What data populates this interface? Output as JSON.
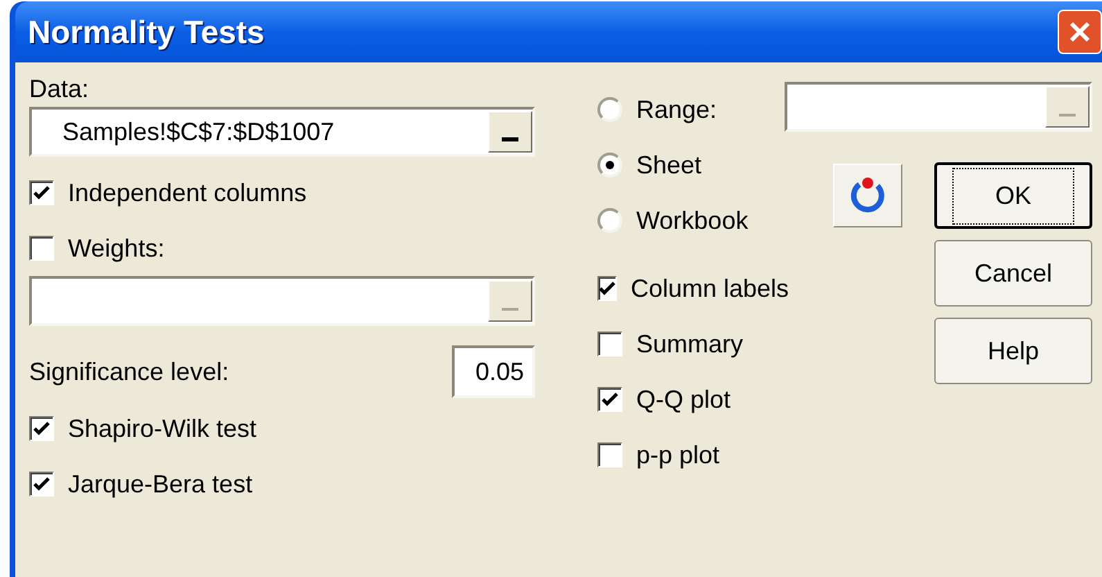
{
  "window": {
    "title": "Normality Tests"
  },
  "data": {
    "label": "Data:",
    "value": "Samples!$C$7:$D$1007",
    "disabled": false
  },
  "independent_columns": {
    "label": "Independent columns",
    "checked": true
  },
  "weights": {
    "label": "Weights:",
    "checked": false,
    "disabled": true
  },
  "significance": {
    "label": "Significance level:",
    "value": "0.05"
  },
  "tests": [
    {
      "label": "Shapiro-Wilk test",
      "checked": true
    },
    {
      "label": "Jarque-Bera test",
      "checked": true
    }
  ],
  "source": [
    {
      "label": "Range:",
      "selected": false
    },
    {
      "label": "Sheet",
      "selected": true
    },
    {
      "label": "Workbook",
      "selected": false
    }
  ],
  "range_field": {
    "disabled": true
  },
  "outputs": [
    {
      "label": "Column labels",
      "checked": true
    },
    {
      "label": "Summary",
      "checked": false
    },
    {
      "label": "Q-Q plot",
      "checked": true
    },
    {
      "label": "p-p plot",
      "checked": false
    }
  ],
  "buttons": [
    {
      "label": "OK",
      "default": true
    },
    {
      "label": "Cancel",
      "default": false
    },
    {
      "label": "Help",
      "default": false
    }
  ]
}
